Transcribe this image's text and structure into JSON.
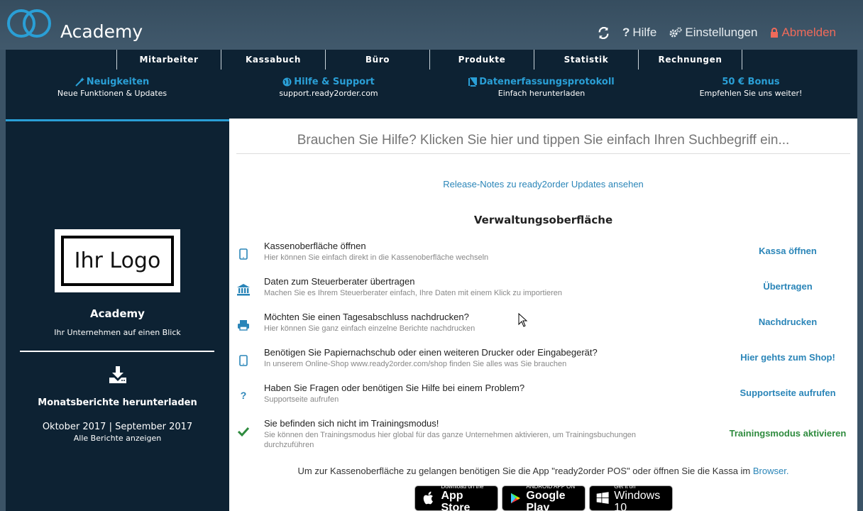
{
  "header": {
    "app_title": "Academy",
    "actions": {
      "refresh_icon": "refresh-icon",
      "help_label": "Hilfe",
      "settings_label": "Einstellungen",
      "logout_label": "Abmelden"
    }
  },
  "nav": {
    "tabs": [
      "Mitarbeiter",
      "Kassabuch",
      "Büro",
      "Produkte",
      "Statistik",
      "Rechnungen"
    ],
    "links": [
      {
        "title": "Neuigkeiten",
        "sub": "Neue Funktionen & Updates",
        "icon": "magic-wand-icon"
      },
      {
        "title": "Hilfe & Support",
        "sub": "support.ready2order.com",
        "icon": "globe-icon"
      },
      {
        "title": "Datenerfassungsprotokoll",
        "sub": "Einfach herunterladen",
        "icon": "book-icon"
      },
      {
        "title": "50 € Bonus",
        "sub": "Empfehlen Sie uns weiter!",
        "icon": ""
      }
    ]
  },
  "sidebar": {
    "logo_text": "Ihr Logo",
    "company": "Academy",
    "company_sub": "Ihr Unternehmen auf einen Blick",
    "report_title": "Monatsberichte herunterladen",
    "report_months": "Oktober 2017 | September 2017",
    "report_all": "Alle Berichte anzeigen"
  },
  "main": {
    "search_placeholder": "Brauchen Sie Hilfe? Klicken Sie hier und tippen Sie einfach Ihren Suchbegriff ein...",
    "release_notes": "Release-Notes zu ready2order Updates ansehen",
    "section_title": "Verwaltungsoberfläche",
    "rows": [
      {
        "icon": "tablet-icon",
        "title": "Kassenoberfläche öffnen",
        "desc": "Hier können Sie einfach direkt in die Kassenoberfläche wechseln",
        "action": "Kassa öffnen"
      },
      {
        "icon": "bank-icon",
        "title": "Daten zum Steuerberater übertragen",
        "desc": "Machen Sie es Ihrem Steuerberater einfach, Ihre Daten mit einem Klick zu importieren",
        "action": "Übertragen"
      },
      {
        "icon": "printer-icon",
        "title": "Möchten Sie einen Tagesabschluss nachdrucken?",
        "desc": "Hier können Sie ganz einfach einzelne Berichte nachdrucken",
        "action": "Nachdrucken"
      },
      {
        "icon": "tablet-icon",
        "title": "Benötigen Sie Papiernachschub oder einen weiteren Drucker oder Eingabegerät?",
        "desc": "In unserem Online-Shop www.ready2order.com/shop finden Sie alles was Sie brauchen",
        "action": "Hier gehts zum Shop!"
      },
      {
        "icon": "question-icon",
        "title": "Haben Sie Fragen oder benötigen Sie Hilfe bei einem Problem?",
        "desc": "Supportseite aufrufen",
        "action": "Supportseite aufrufen"
      },
      {
        "icon": "check-icon",
        "title": "Sie befinden sich nicht im Trainingsmodus!",
        "desc": "Sie können den Trainingsmodus hier global für das ganze Unternehmen aktivieren, um Trainingsbuchungen durchzuführen",
        "action": "Trainingsmodus aktivieren"
      }
    ],
    "footer_note": "Um zur Kassenoberfläche zu gelangen benötigen Sie die App \"ready2order POS\" oder öffnen Sie die Kassa im",
    "footer_link": "Browser.",
    "badges": [
      {
        "small": "Download on the",
        "big": "App Store",
        "icon": "apple-icon"
      },
      {
        "small": "ANDROID APP ON",
        "big": "Google Play",
        "icon": "google-play-icon"
      },
      {
        "small": "Get it on",
        "big": "Windows 10",
        "icon": "windows-icon"
      }
    ]
  },
  "colors": {
    "accent": "#2a9fd6",
    "navy": "#0d2233",
    "logout": "#f06a5a",
    "green": "#2e8b3e"
  }
}
